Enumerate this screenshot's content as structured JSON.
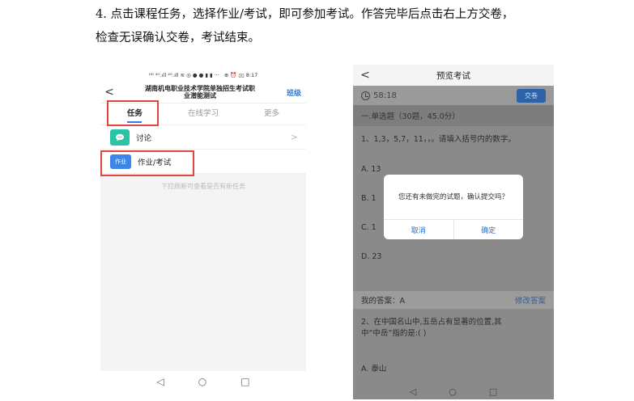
{
  "doc": {
    "step_line1": "4. 点击课程任务，选择作业/考试，即可参加考试。作答完毕后点击右上方交卷，",
    "step_line2": "检查无误确认交卷，考试结束。"
  },
  "left_phone": {
    "status_left": "ᴴᴰ ⁴ᴳ.ıll ⁴ᴳ.ıll ≋ ◎ ● ● ▮ ▮ ···",
    "status_right": "⊕ ⏰ ▯▯ 8:17",
    "back_glyph": "<",
    "title_line1": "湖南机电职业技术学院单独招生考试职",
    "title_line2": "业潜能测试",
    "class_label": "班级",
    "tabs": [
      "任务",
      "在线学习",
      "更多"
    ],
    "items": [
      {
        "icon_name": "chat-bubble-icon",
        "icon_text": "",
        "label": "讨论"
      },
      {
        "icon_name": "homework-badge-icon",
        "icon_text": "作业",
        "label": "作业/考试"
      }
    ],
    "chevron": ">",
    "hint": "下拉刷新可查看是否有新任务",
    "nav": [
      "◁",
      "○",
      "□"
    ],
    "highlight_color": "#e0463e",
    "accent_color": "#2f7de1"
  },
  "right_phone": {
    "back_glyph": "<",
    "title": "预览考试",
    "timer": "58:18",
    "submit_label": "交卷",
    "section_title": "一.单选题（30题，45.0分）",
    "question1": "1、1,3，5,7，11，，。请填入括号内的数字。",
    "options_visible": [
      "A.  13",
      "B.  1",
      "C.  1",
      "D.  23"
    ],
    "my_answer_label": "我的答案：A",
    "modify_label": "修改答案",
    "question2_line1": "2、在中国名山中,五岳占有显著的位置,其",
    "question2_line2": "中“中岳”指的是:( )",
    "question2_option": "A.   泰山",
    "dialog_message": "您还有未做完的试题，确认提交吗？",
    "dialog_cancel": "取消",
    "dialog_confirm": "确定",
    "nav": [
      "◁",
      "○",
      "□"
    ],
    "submit_color": "#2e62a8"
  }
}
